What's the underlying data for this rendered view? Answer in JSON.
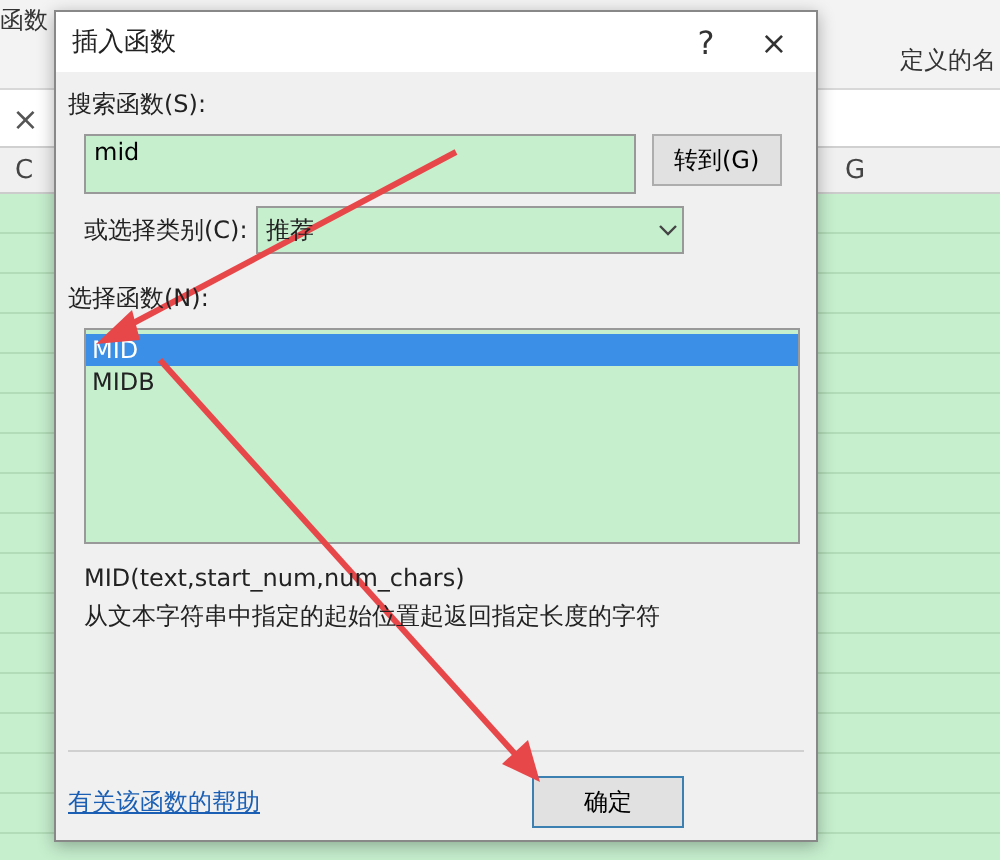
{
  "ribbon": {
    "items": [
      "函数",
      "定义的名"
    ]
  },
  "formula_bar": {
    "cancel": "×"
  },
  "columns": [
    "C",
    "G"
  ],
  "dialog": {
    "title": "插入函数",
    "help": "?",
    "close": "×",
    "search": {
      "label": "搜索函数(S):",
      "value": "mid",
      "button": "转到(G)"
    },
    "category": {
      "label": "或选择类别(C):",
      "value": "推荐"
    },
    "functions": {
      "label": "选择函数(N):",
      "items": [
        {
          "name": "MID",
          "selected": true
        },
        {
          "name": "MIDB",
          "selected": false
        }
      ]
    },
    "signature": "MID(text,start_num,num_chars)",
    "description": "从文本字符串中指定的起始位置起返回指定长度的字符",
    "help_link": "有关该函数的帮助",
    "buttons": [
      "确定"
    ]
  }
}
